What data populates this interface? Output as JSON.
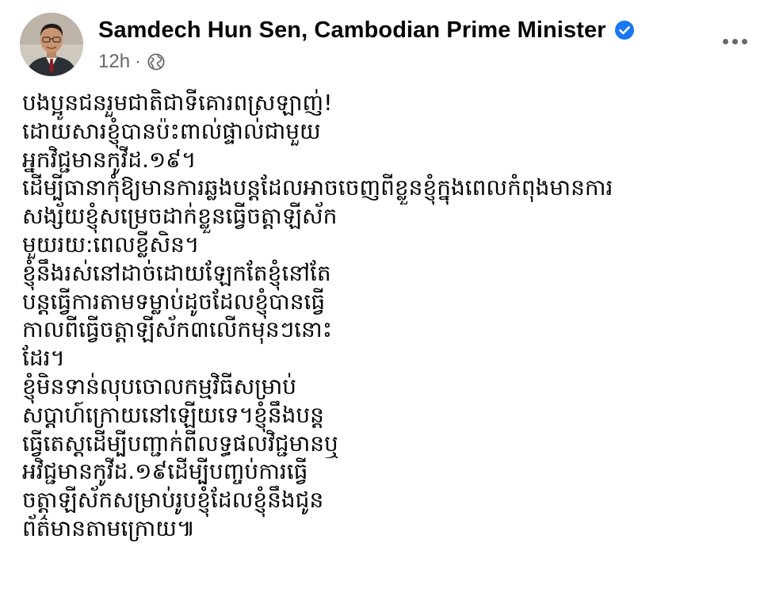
{
  "post": {
    "author": {
      "name": "Samdech Hun Sen, Cambodian Prime Minister",
      "verified_icon": "verified-badge-icon",
      "verified_color": "#1877f2"
    },
    "meta": {
      "time": "12h",
      "separator": "·",
      "audience_icon": "globe-icon"
    },
    "more_icon": "more-options-icon",
    "body_lines": [
      "បងប្អូនជនរួមជាតិជាទីគោរពស្រឡាញ់!",
      "ដោយសារខ្ញុំបានប៉ះពាល់ផ្ទាល់ជាមួយ",
      "អ្នកវិជ្ជមានកូវីដ.១៩។",
      "ដើម្បីធានាកុំឱ្យមានការឆ្លងបន្តដែលអាចចេញពីខ្លួនខ្ញុំក្នុងពេលកំពុងមានការ",
      "សង្ស័យខ្ញុំសម្រេចដាក់ខ្លួនធ្វើចត្តាឡីស័ក",
      "មួយរយ:ពេលខ្លីសិន។",
      "ខ្ញុំនឹងរស់នៅដាច់ដោយឡែកតែខ្ញុំនៅតែ",
      "បន្តធ្វើការតាមទម្លាប់ដូចដែលខ្ញុំបានធ្វើ",
      "កាលពីធ្វើចត្តាឡីស័ក៣លើកមុនៗនោះ",
      "ដែរ។",
      "ខ្ញុំមិនទាន់លុបចោលកម្មវិធីសម្រាប់",
      "សប្តាហ៍ក្រោយនៅឡើយទេ។ខ្ញុំនឹងបន្ត",
      "ធ្វើតេស្តដើម្បីបញ្ជាក់ពីលទ្ធផលវិជ្ជមានឬ",
      "អវិជ្ជមានកូវីដ.១៩ដើម្បីបញ្ចប់ការធ្វើ",
      "ចត្តាឡីស័កសម្រាប់រូបខ្ញុំដែលខ្ញុំនឹងជូន",
      "ព័ត៌មានតាមក្រោយ៕"
    ]
  }
}
